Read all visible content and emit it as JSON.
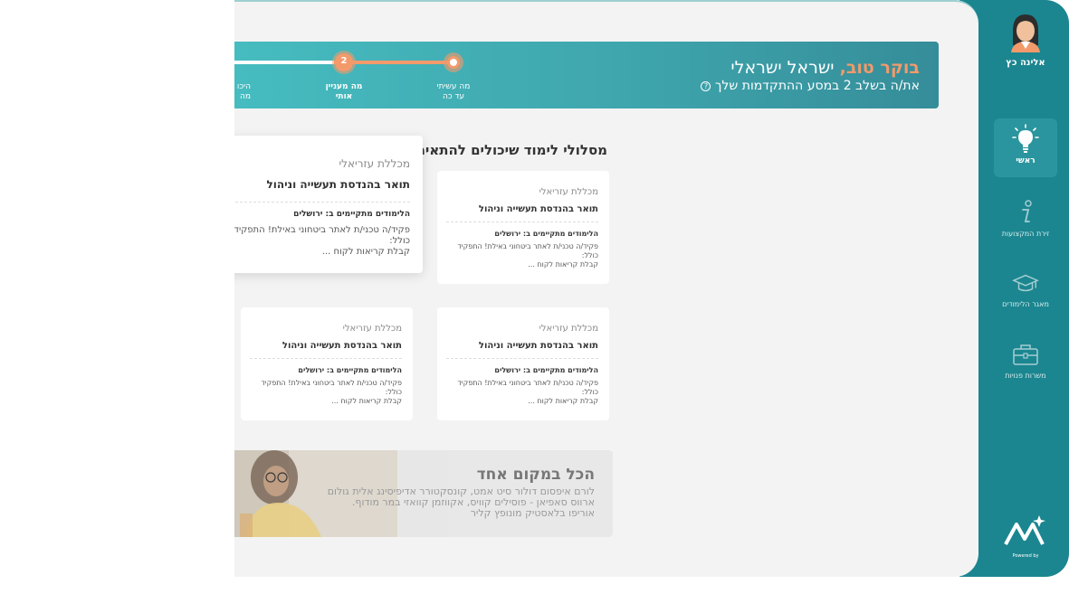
{
  "user": {
    "name": "אלינה כץ"
  },
  "nav": {
    "items": [
      {
        "label": "ראשי",
        "icon": "lightbulb-icon",
        "active": true
      },
      {
        "label": "זירת המקצועות",
        "icon": "info-icon",
        "active": false
      },
      {
        "label": "מאגר הלימודים",
        "icon": "graduation-cap-icon",
        "active": false
      },
      {
        "label": "משרות פנויות",
        "icon": "briefcase-icon",
        "active": false
      }
    ]
  },
  "brand": {
    "powered": "Powered by"
  },
  "header": {
    "greeting_strong": "בוקר טוב,",
    "greeting_name": "ישראל ישראלי",
    "subtitle": "את/ה בשלב 2 במסע ההתקדמות שלך",
    "help_icon": "?"
  },
  "progress": {
    "steps": [
      {
        "line1": "מה עשיתי",
        "line2": "עד כה"
      },
      {
        "line1": "מה מעניין",
        "line2": "אותי",
        "number": "2"
      },
      {
        "line1": "היכו",
        "line2": "מה"
      }
    ]
  },
  "section": {
    "title": "מסלולי לימוד שיכולים להתאים ל"
  },
  "cards": [
    {
      "college": "מכללת עזריאלי",
      "title": "תואר בהנדסת תעשייה וניהול",
      "location": "הלימודים מתקיימים ב: ירושלים",
      "desc1": "פקיד/ה טכני/ת לאתר ביטחוני באילת! התפקיד",
      "desc2": "כולל:",
      "desc3": "קבלת קריאות לקוח ..."
    },
    {
      "college": "מכללת עזריאלי",
      "title": "תואר בהנדסת תעשייה וניהול",
      "location": "הלימודים מתקיימים ב: ירושלים",
      "desc1": "פקיד/ה טכני/ת לאתר ביטחוני באילת! התפקיד",
      "desc2": "כולל:",
      "desc3": "קבלת קריאות לקוח ..."
    },
    {
      "college": "מכללת עזריאלי",
      "title": "תואר בהנדסת תעשייה וניהול",
      "location": "הלימודים מתקיימים ב: ירושלים",
      "desc1": "פקיד/ה טכני/ת לאתר ביטחוני באילת! התפקיד",
      "desc2": "כולל:",
      "desc3": "קבלת קריאות לקוח ..."
    },
    {
      "college": "מכללת עזריאלי",
      "title": "תואר בהנדסת תעשייה וניהול",
      "location": "הלימודים מתקיימים ב: ירושלים",
      "desc1": "פקיד/ה טכני/ת לאתר ביטחוני באילת! התפקיד",
      "desc2": "כולל:",
      "desc3": "קבלת קריאות לקוח ..."
    }
  ],
  "promo": {
    "title": "הכל במקום אחד",
    "line1": "לורם איפסום דולור סיט אמט, קונסקטורר אדיפיסינג אלית גולום",
    "line2": "ארווס סאפיאן - פוסילים קוויס, אקווזמן קוואזי במר מודוף.",
    "line3": "אוריפו בלאסטיק מונופץ קליר"
  },
  "colors": {
    "sidebar": "#1b8690",
    "accent": "#f39a6b",
    "banner": "#3fa6ad",
    "bg": "#f3f3f3"
  }
}
